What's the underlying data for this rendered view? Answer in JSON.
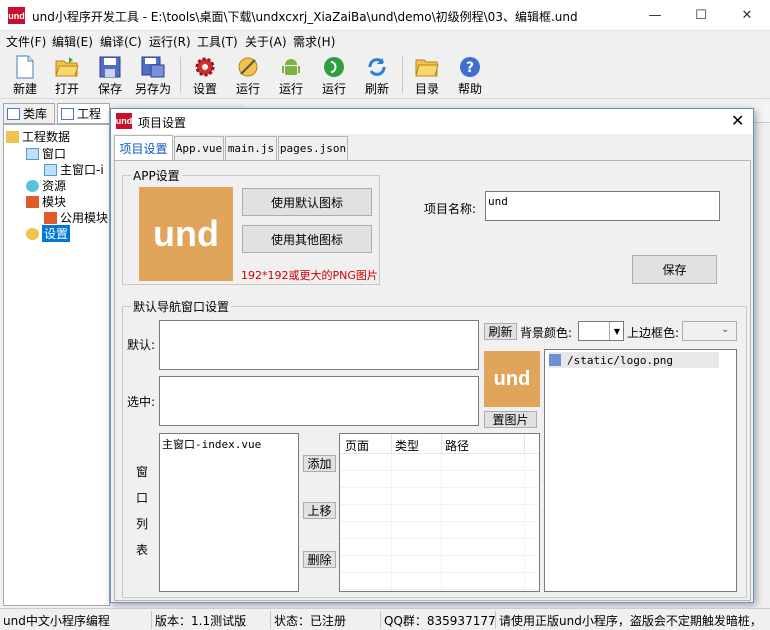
{
  "window": {
    "title": "und小程序开发工具 - E:\\tools\\桌面\\下载\\undxcxrj_XiaZaiBa\\und\\demo\\初级例程\\03、编辑框.und",
    "logo_text": "und",
    "minimize": "—",
    "maximize": "☐",
    "close": "✕"
  },
  "menu": [
    "文件(F)",
    "编辑(E)",
    "编译(C)",
    "运行(R)",
    "工具(T)",
    "关于(A)",
    "需求(H)"
  ],
  "toolbar": [
    "新建",
    "打开",
    "保存",
    "另存为",
    "设置",
    "运行",
    "运行",
    "运行",
    "刷新",
    "目录",
    "帮助"
  ],
  "left_tabs": [
    "类库",
    "工程"
  ],
  "tree": [
    "工程数据",
    "窗口",
    "主窗口-i",
    "资源",
    "模块",
    "公用模块",
    "设置"
  ],
  "dialog": {
    "title": "项目设置",
    "logo_text": "und",
    "close": "✕",
    "tabs": [
      "项目设置",
      "App.vue",
      "main.js",
      "pages.json"
    ],
    "app_group": "APP设置",
    "logo_big": "und",
    "btn_default_icon": "使用默认图标",
    "btn_other_icon": "使用其他图标",
    "icon_hint": "192*192或更大的PNG图片",
    "project_name_label": "项目名称:",
    "project_name_value": "und",
    "save": "保存",
    "nav_group": "默认导航窗口设置",
    "default_label": "默认:",
    "selected_label": "选中:",
    "refresh": "刷新",
    "bg_color_label": "背景颜色:",
    "top_border_label": "上边框色:",
    "nav_logo": "und",
    "set_image": "置图片",
    "image_list": [
      "/static/logo.png"
    ],
    "window_list_label": [
      "窗",
      "口",
      "列",
      "表"
    ],
    "window_list": [
      "主窗口-index.vue"
    ],
    "add": "添加",
    "move_up": "上移",
    "delete": "删除",
    "columns": [
      "页面",
      "类型",
      "路径"
    ]
  },
  "status": [
    "und中文小程序编程",
    "版本：1.1测试版",
    "状态：已注册",
    "QQ群：835937177",
    "请使用正版und小程序，盗版会不定期触发暗桩，"
  ],
  "colors": {
    "accent": "#c8102e",
    "logo_bg": "#e0a55a",
    "hint": "#cc0000"
  }
}
